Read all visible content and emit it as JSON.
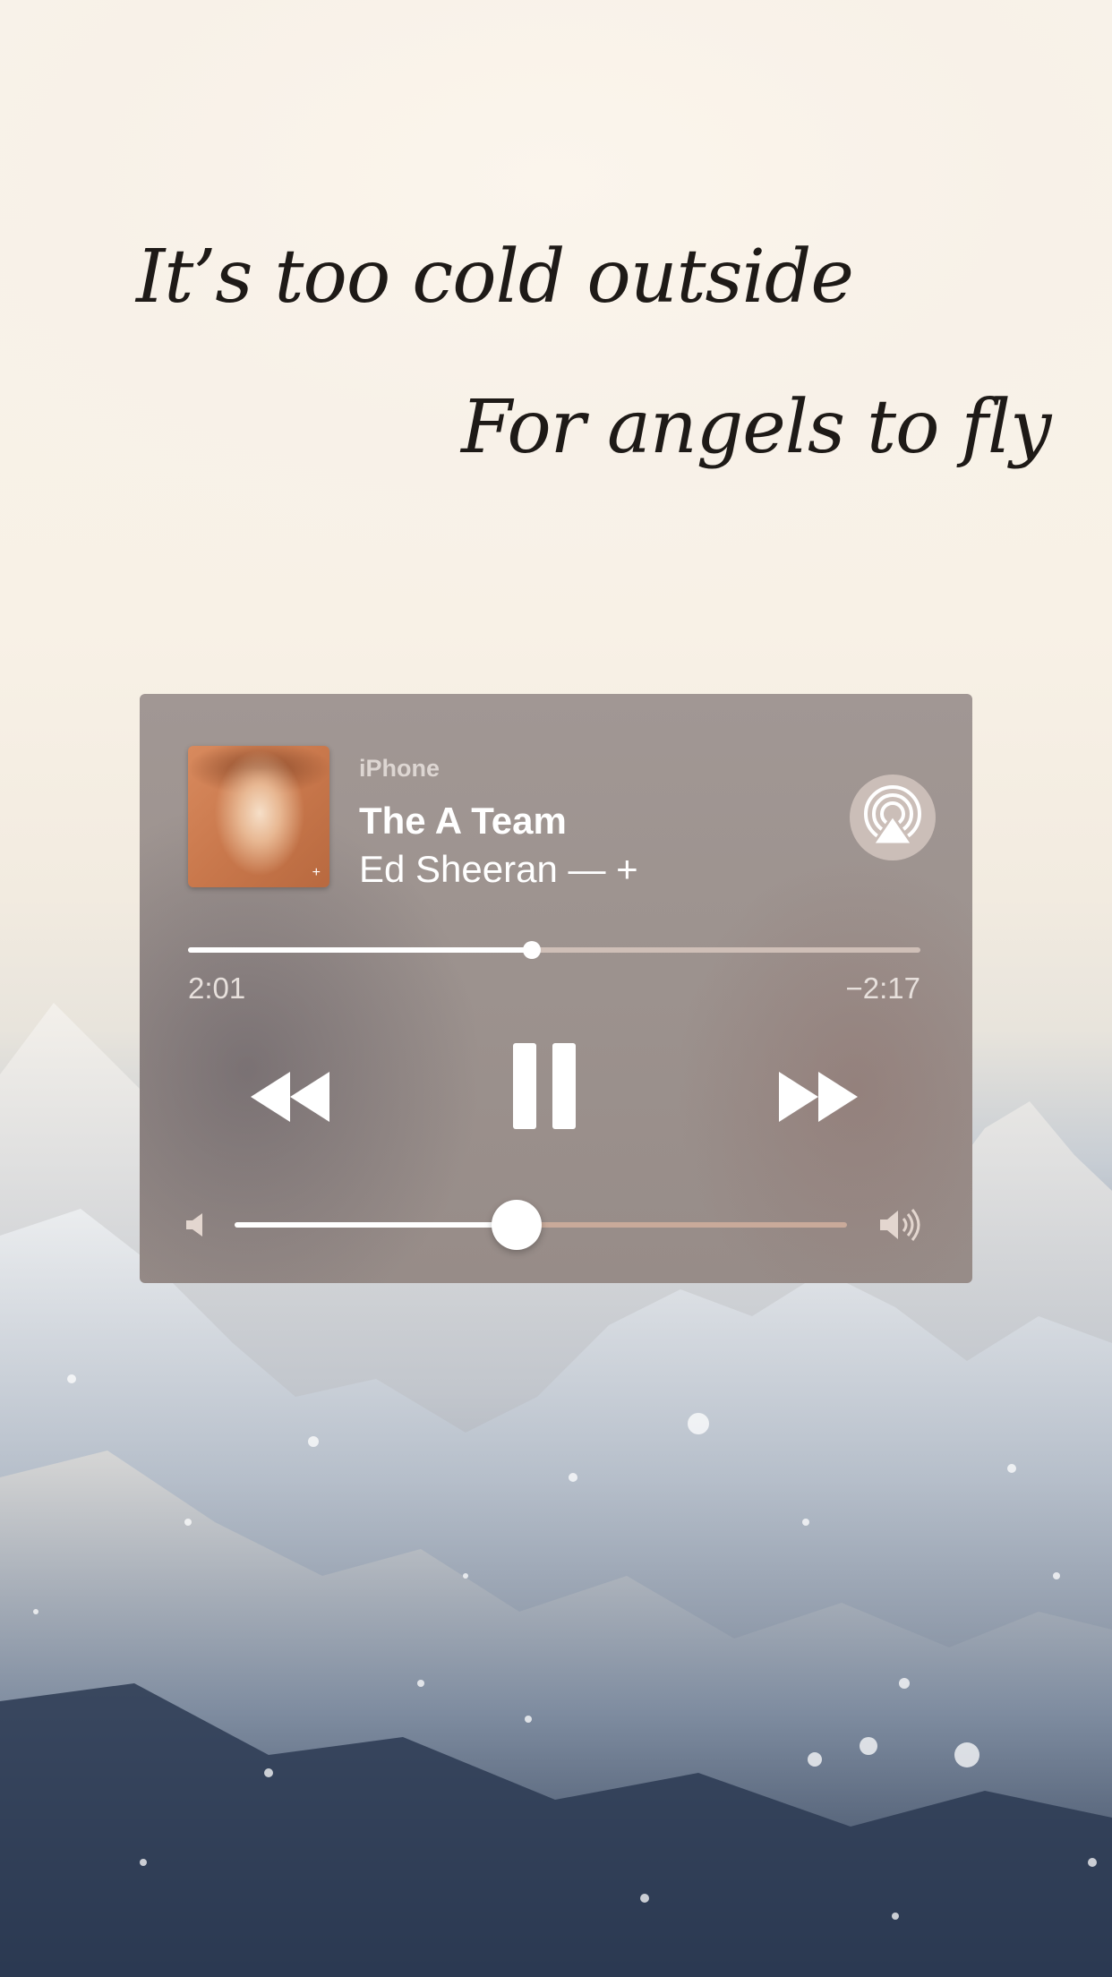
{
  "lyrics": {
    "line1": "It’s too cold outside",
    "line2": "For angels to fly"
  },
  "now_playing": {
    "device": "iPhone",
    "title": "The A Team",
    "artist": "Ed Sheeran — +",
    "album_badge": "+",
    "elapsed": "2:01",
    "remaining": "−2:17",
    "progress": 0.47,
    "volume": 0.46
  },
  "icons": {
    "airplay": "airplay-icon",
    "rewind": "rewind-icon",
    "pause": "pause-icon",
    "forward": "fast-forward-icon",
    "volume_low": "volume-low-icon",
    "volume_high": "volume-high-icon"
  },
  "colors": {
    "widget_background": "#9d938f",
    "accent": "#ffffff",
    "album_art": "#c9784c"
  }
}
